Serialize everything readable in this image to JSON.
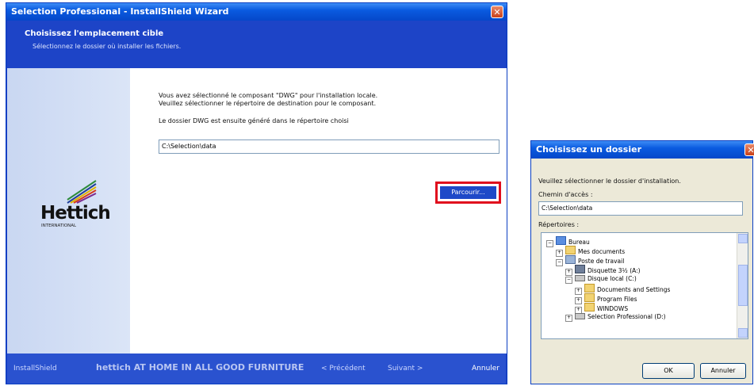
{
  "wizard": {
    "title": "Selection Professional - InstallShield Wizard",
    "header_title": "Choisissez l'emplacement cible",
    "header_subtitle": "Sélectionnez le dossier où installer les fichiers.",
    "logo_text": "Hettich",
    "logo_subtext": "INTERNATIONAL",
    "line1": "Vous avez sélectionné le composant \"DWG\" pour l'installation locale.",
    "line2": "Veuillez sélectionner le répertoire de destination pour le composant.",
    "line3": "Le dossier DWG est ensuite généré dans le répertoire choisi",
    "path_value": "C:\\Selection\\data",
    "browse_label": "Parcourir...",
    "brand_left": "InstallShield",
    "brand_slogan": "hettich  AT HOME IN ALL GOOD FURNITURE",
    "back_label": "< Précédent",
    "next_label": "Suivant >",
    "cancel_label": "Annuler"
  },
  "dialog": {
    "title": "Choisissez un dossier",
    "prompt": "Veuillez sélectionner le dossier d'installation.",
    "path_label": "Chemin d'accès :",
    "path_value": "C:\\Selection\\data",
    "dirs_label": "Répertoires :",
    "tree": [
      {
        "label": "Bureau",
        "icon": "desktop-icon"
      },
      {
        "label": "Mes documents",
        "icon": "folder-icon"
      },
      {
        "label": "Poste de travail",
        "icon": "computer-icon"
      },
      {
        "label": "Disquette 3½ (A:)",
        "icon": "floppy-icon"
      },
      {
        "label": "Disque local (C:)",
        "icon": "drive-icon"
      },
      {
        "label": "Documents and Settings",
        "icon": "folder-icon"
      },
      {
        "label": "Program Files",
        "icon": "folder-icon"
      },
      {
        "label": "WINDOWS",
        "icon": "folder-icon"
      },
      {
        "label": "Selection Professional (D:)",
        "icon": "drive-icon"
      }
    ],
    "ok_label": "OK",
    "cancel_label": "Annuler"
  }
}
